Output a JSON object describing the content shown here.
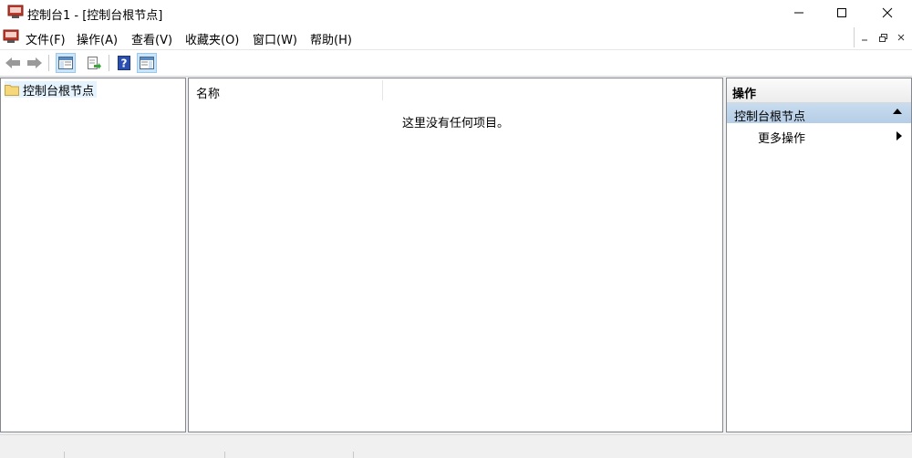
{
  "window": {
    "title": "控制台1 - [控制台根节点]",
    "minimize_icon": "minimize-icon",
    "maximize_icon": "maximize-icon",
    "close_icon": "close-icon"
  },
  "menu": {
    "items": [
      "文件(F)",
      "操作(A)",
      "查看(V)",
      "收藏夹(O)",
      "窗口(W)",
      "帮助(H)"
    ]
  },
  "toolbar": {
    "buttons": [
      "back-arrow-icon",
      "forward-arrow-icon",
      "show-hide-tree-icon",
      "export-list-icon",
      "help-icon",
      "show-hide-action-pane-icon"
    ]
  },
  "tree": {
    "root_label": "控制台根节点"
  },
  "list": {
    "column_name": "名称",
    "empty_message": "这里没有任何项目。"
  },
  "actions": {
    "title": "操作",
    "section_title": "控制台根节点",
    "more_actions": "更多操作"
  },
  "colors": {
    "section_header": "#b9d1ea",
    "selection": "#e5f3ff",
    "pane_border": "#828790"
  }
}
